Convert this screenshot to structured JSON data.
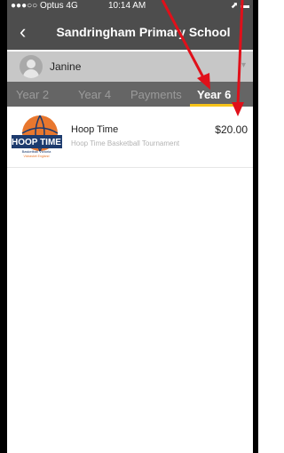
{
  "status_bar": {
    "carrier": "●●●○○ Optus  4G",
    "time": "10:14 AM",
    "right_icons": "⬈ ▬"
  },
  "header": {
    "back_glyph": "‹",
    "title": "Sandringham Primary School"
  },
  "user": {
    "name": "Janine",
    "dropdown_glyph": "▾"
  },
  "tabs": [
    {
      "label": "Year 2",
      "active": false
    },
    {
      "label": "Year 4",
      "active": false
    },
    {
      "label": "Payments",
      "active": false
    },
    {
      "label": "Year 6",
      "active": true
    }
  ],
  "items": [
    {
      "title": "Hoop Time",
      "subtitle": "Hoop Time Basketball Tournament",
      "price": "$20.00",
      "logo_text": "HOOP TIME",
      "logo_caption": "Basketball Victoria",
      "logo_caption_small": "Vicbasket England"
    }
  ],
  "colors": {
    "header_bg": "#4d4d4d",
    "user_row_bg": "#c7c7c7",
    "tabs_bg": "#656565",
    "active_tab_indicator": "#f6c31a",
    "arrow": "#e0101a",
    "logo_navy": "#1d3b6e",
    "logo_orange": "#e8772e"
  }
}
